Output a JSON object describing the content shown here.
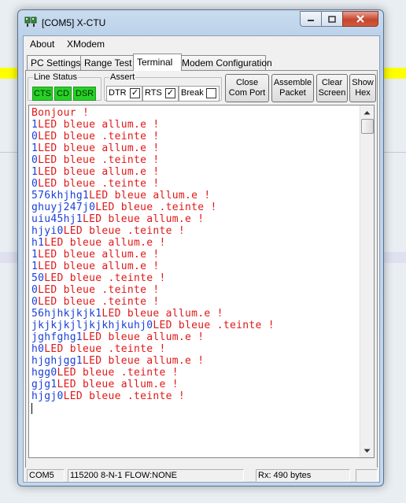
{
  "window": {
    "title": "[COM5] X-CTU"
  },
  "menu": [
    "About",
    "XModem"
  ],
  "tabs": [
    {
      "label": "PC Settings",
      "active": false
    },
    {
      "label": "Range Test",
      "active": false
    },
    {
      "label": "Terminal",
      "active": true
    },
    {
      "label": "Modem Configuration",
      "active": false
    }
  ],
  "line_status": {
    "label": "Line Status",
    "indicators": [
      "CTS",
      "CD",
      "DSR"
    ],
    "indicator_color": "#28d028"
  },
  "assert": {
    "label": "Assert",
    "items": [
      {
        "label": "DTR",
        "checked": true
      },
      {
        "label": "RTS",
        "checked": true
      },
      {
        "label": "Break",
        "checked": false
      }
    ]
  },
  "buttons": [
    {
      "line1": "Close",
      "line2": "Com Port"
    },
    {
      "line1": "Assemble",
      "line2": "Packet"
    },
    {
      "line1": "Clear",
      "line2": "Screen"
    },
    {
      "line1": "Show",
      "line2": "Hex"
    }
  ],
  "terminal": {
    "colors": {
      "received": "#1a3ed8",
      "sent": "#e01818"
    },
    "lines": [
      {
        "rx": "",
        "tx": "Bonjour !"
      },
      {
        "rx": "1",
        "tx": "LED bleue allum.e !"
      },
      {
        "rx": "0",
        "tx": "LED bleue .teinte !"
      },
      {
        "rx": "1",
        "tx": "LED bleue allum.e !"
      },
      {
        "rx": "0",
        "tx": "LED bleue .teinte !"
      },
      {
        "rx": "1",
        "tx": "LED bleue allum.e !"
      },
      {
        "rx": "0",
        "tx": "LED bleue .teinte !"
      },
      {
        "rx": "576khjhg1",
        "tx": "LED bleue allum.e !"
      },
      {
        "rx": "ghuyj247j0",
        "tx": "LED bleue .teinte !"
      },
      {
        "rx": "uiu45hj1",
        "tx": "LED bleue allum.e !"
      },
      {
        "rx": "hjyi0",
        "tx": "LED bleue .teinte !"
      },
      {
        "rx": "h1",
        "tx": "LED bleue allum.e !"
      },
      {
        "rx": "1",
        "tx": "LED bleue allum.e !"
      },
      {
        "rx": "1",
        "tx": "LED bleue allum.e !"
      },
      {
        "rx": "50",
        "tx": "LED bleue .teinte !"
      },
      {
        "rx": "0",
        "tx": "LED bleue .teinte !"
      },
      {
        "rx": "0",
        "tx": "LED bleue .teinte !"
      },
      {
        "rx": "56hjhkjkjk1",
        "tx": "LED bleue allum.e !"
      },
      {
        "rx": "jkjkjkjljkjkhjkuhj0",
        "tx": "LED bleue .teinte !"
      },
      {
        "rx": "jghfghg1",
        "tx": "LED bleue allum.e !"
      },
      {
        "rx": "h0",
        "tx": "LED bleue .teinte !"
      },
      {
        "rx": "hjghjgg1",
        "tx": "LED bleue allum.e !"
      },
      {
        "rx": "hgg0",
        "tx": "LED bleue .teinte !"
      },
      {
        "rx": "gjg1",
        "tx": "LED bleue allum.e !"
      },
      {
        "rx": "hjgj0",
        "tx": "LED bleue .teinte !"
      }
    ]
  },
  "status": {
    "port": "COM5",
    "settings": "115200 8-N-1  FLOW:NONE",
    "rx": "Rx: 490 bytes"
  }
}
